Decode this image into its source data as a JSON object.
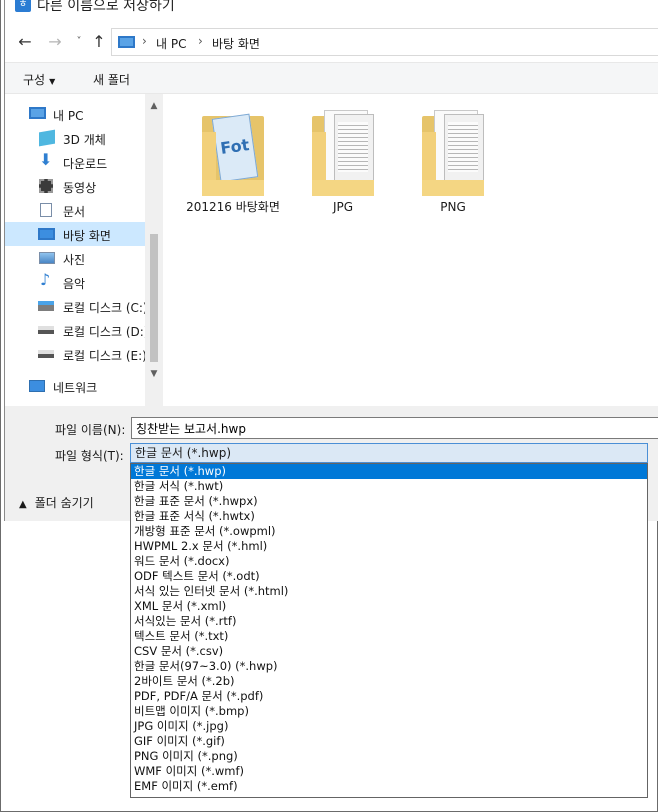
{
  "window": {
    "title": "다른 이름으로 저장하기"
  },
  "address": {
    "crumbs": [
      "내 PC",
      "바탕 화면"
    ],
    "separator": "›"
  },
  "toolbar": {
    "organize_label": "구성",
    "new_folder_label": "새 폴더"
  },
  "sidebar": {
    "items": [
      {
        "label": "내 PC",
        "icon": "pc-icon"
      },
      {
        "label": "3D 개체",
        "icon": "cube-icon"
      },
      {
        "label": "다운로드",
        "icon": "download-icon"
      },
      {
        "label": "동영상",
        "icon": "video-icon"
      },
      {
        "label": "문서",
        "icon": "document-icon"
      },
      {
        "label": "바탕 화면",
        "icon": "desktop-icon",
        "selected": true
      },
      {
        "label": "사진",
        "icon": "picture-icon"
      },
      {
        "label": "음악",
        "icon": "music-icon"
      },
      {
        "label": "로컬 디스크 (C:)",
        "icon": "drive-c-icon"
      },
      {
        "label": "로컬 디스크 (D:)",
        "icon": "drive-icon"
      },
      {
        "label": "로컬 디스크 (E:)",
        "icon": "drive-icon"
      },
      {
        "label": "네트워크",
        "icon": "network-icon"
      }
    ]
  },
  "folders": [
    {
      "name": "201216 바탕화면"
    },
    {
      "name": "JPG"
    },
    {
      "name": "PNG"
    }
  ],
  "form": {
    "filename_label": "파일 이름(N):",
    "filename_value": "칭찬받는 보고서.hwp",
    "filetype_label": "파일 형식(T):",
    "filetype_value": "한글 문서 (*.hwp)",
    "hide_folders_label": "폴더 숨기기"
  },
  "filetype_options": [
    "한글 문서 (*.hwp)",
    "한글 서식 (*.hwt)",
    "한글 표준 문서 (*.hwpx)",
    "한글 표준 서식 (*.hwtx)",
    "개방형 표준 문서 (*.owpml)",
    "HWPML 2.x 문서 (*.hml)",
    "워드 문서 (*.docx)",
    "ODF 텍스트 문서 (*.odt)",
    "서식 있는 인터넷 문서 (*.html)",
    "XML 문서 (*.xml)",
    "서식있는 문서 (*.rtf)",
    "텍스트 문서 (*.txt)",
    "CSV 문서 (*.csv)",
    "한글 문서(97~3.0) (*.hwp)",
    "2바이트 문서 (*.2b)",
    "PDF, PDF/A 문서 (*.pdf)",
    "비트맵 이미지 (*.bmp)",
    "JPG 이미지 (*.jpg)",
    "GIF 이미지 (*.gif)",
    "PNG 이미지 (*.png)",
    "WMF 이미지 (*.wmf)",
    "EMF 이미지 (*.emf)"
  ],
  "selected_option_index": 0,
  "colors": {
    "selection": "#0078d7",
    "nav_selected": "#cce8ff",
    "folder": "#e6c46a"
  }
}
